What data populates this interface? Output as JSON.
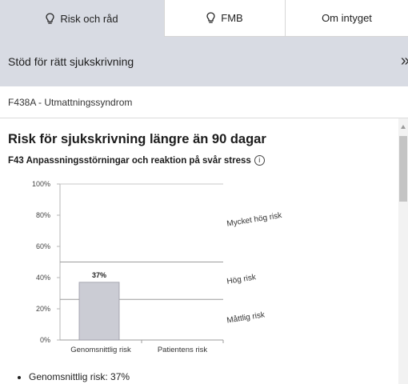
{
  "tabs": [
    {
      "label": "Risk och råd",
      "icon": "lightbulb-icon",
      "active": true
    },
    {
      "label": "FMB",
      "icon": "lightbulb-icon",
      "active": false
    },
    {
      "label": "Om intyget",
      "active": false
    }
  ],
  "banner": {
    "title": "Stöd för rätt sjukskrivning",
    "collapse_icon": "double-chevron-right-icon"
  },
  "diagnosis": "F438A - Utmattningssyndrom",
  "risk": {
    "title": "Risk för sjukskrivning längre än 90 dagar",
    "subtitle": "F43 Anpassningsstörningar och reaktion på svår stress",
    "info_icon_glyph": "i"
  },
  "chart_data": {
    "type": "bar",
    "categories": [
      "Genomsnittlig risk",
      "Patientens risk"
    ],
    "values": [
      37,
      null
    ],
    "value_labels": [
      "37%",
      ""
    ],
    "ylim": [
      0,
      100
    ],
    "yticks": [
      "0%",
      "20%",
      "40%",
      "60%",
      "80%",
      "100%"
    ],
    "bands": [
      {
        "label": "Måttlig risk",
        "from": 0,
        "to": 26
      },
      {
        "label": "Hög risk",
        "from": 26,
        "to": 50
      },
      {
        "label": "Mycket hög risk",
        "from": 50,
        "to": 100
      }
    ],
    "bar_color": "#cbccd4"
  },
  "summary": [
    "Genomsnittlig risk: 37%"
  ]
}
